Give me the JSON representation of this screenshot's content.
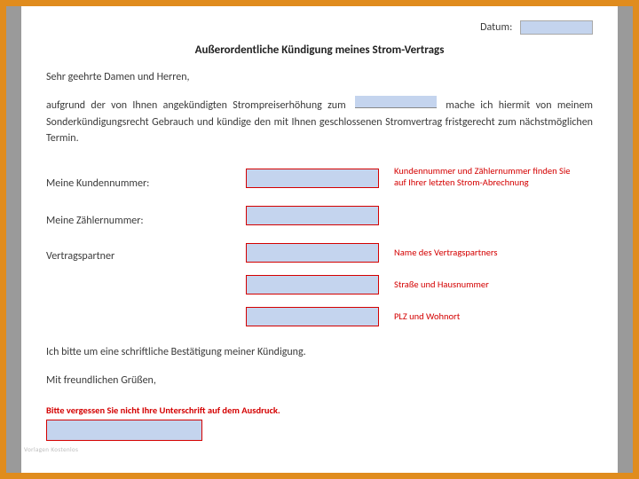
{
  "date": {
    "label": "Datum:"
  },
  "title": "Außerordentliche Kündigung meines Strom-Vertrags",
  "salutation": "Sehr geehrte Damen und Herren,",
  "body_before": "aufgrund der von Ihnen angekündigten Strompreiserhöhung zum",
  "body_after": "mache ich hiermit von meinem Sonderkündigungsrecht Gebrauch und kündige den mit Ihnen geschlossenen Stromvertrag fristgerecht zum nächstmöglichen Termin.",
  "labels": {
    "customer_no": "Meine Kundennummer:",
    "meter_no": "Meine Zählernummer:",
    "partner": "Vertragspartner"
  },
  "hints": {
    "numbers": "Kundennummer und Zählernummer finden Sie auf Ihrer letzten Strom-Abrechnung",
    "partner_name": "Name des Vertragspartners",
    "street": "Straße und Hausnummer",
    "city": "PLZ und Wohnort"
  },
  "confirm_line": "Ich bitte um eine schriftliche Bestätigung meiner Kündigung.",
  "closing": "Mit freundlichen Grüßen,",
  "signature_hint": "Bitte vergessen Sie nicht Ihre Unterschrift auf dem Ausdruck.",
  "watermark": "Vorlagen Kostenlos"
}
